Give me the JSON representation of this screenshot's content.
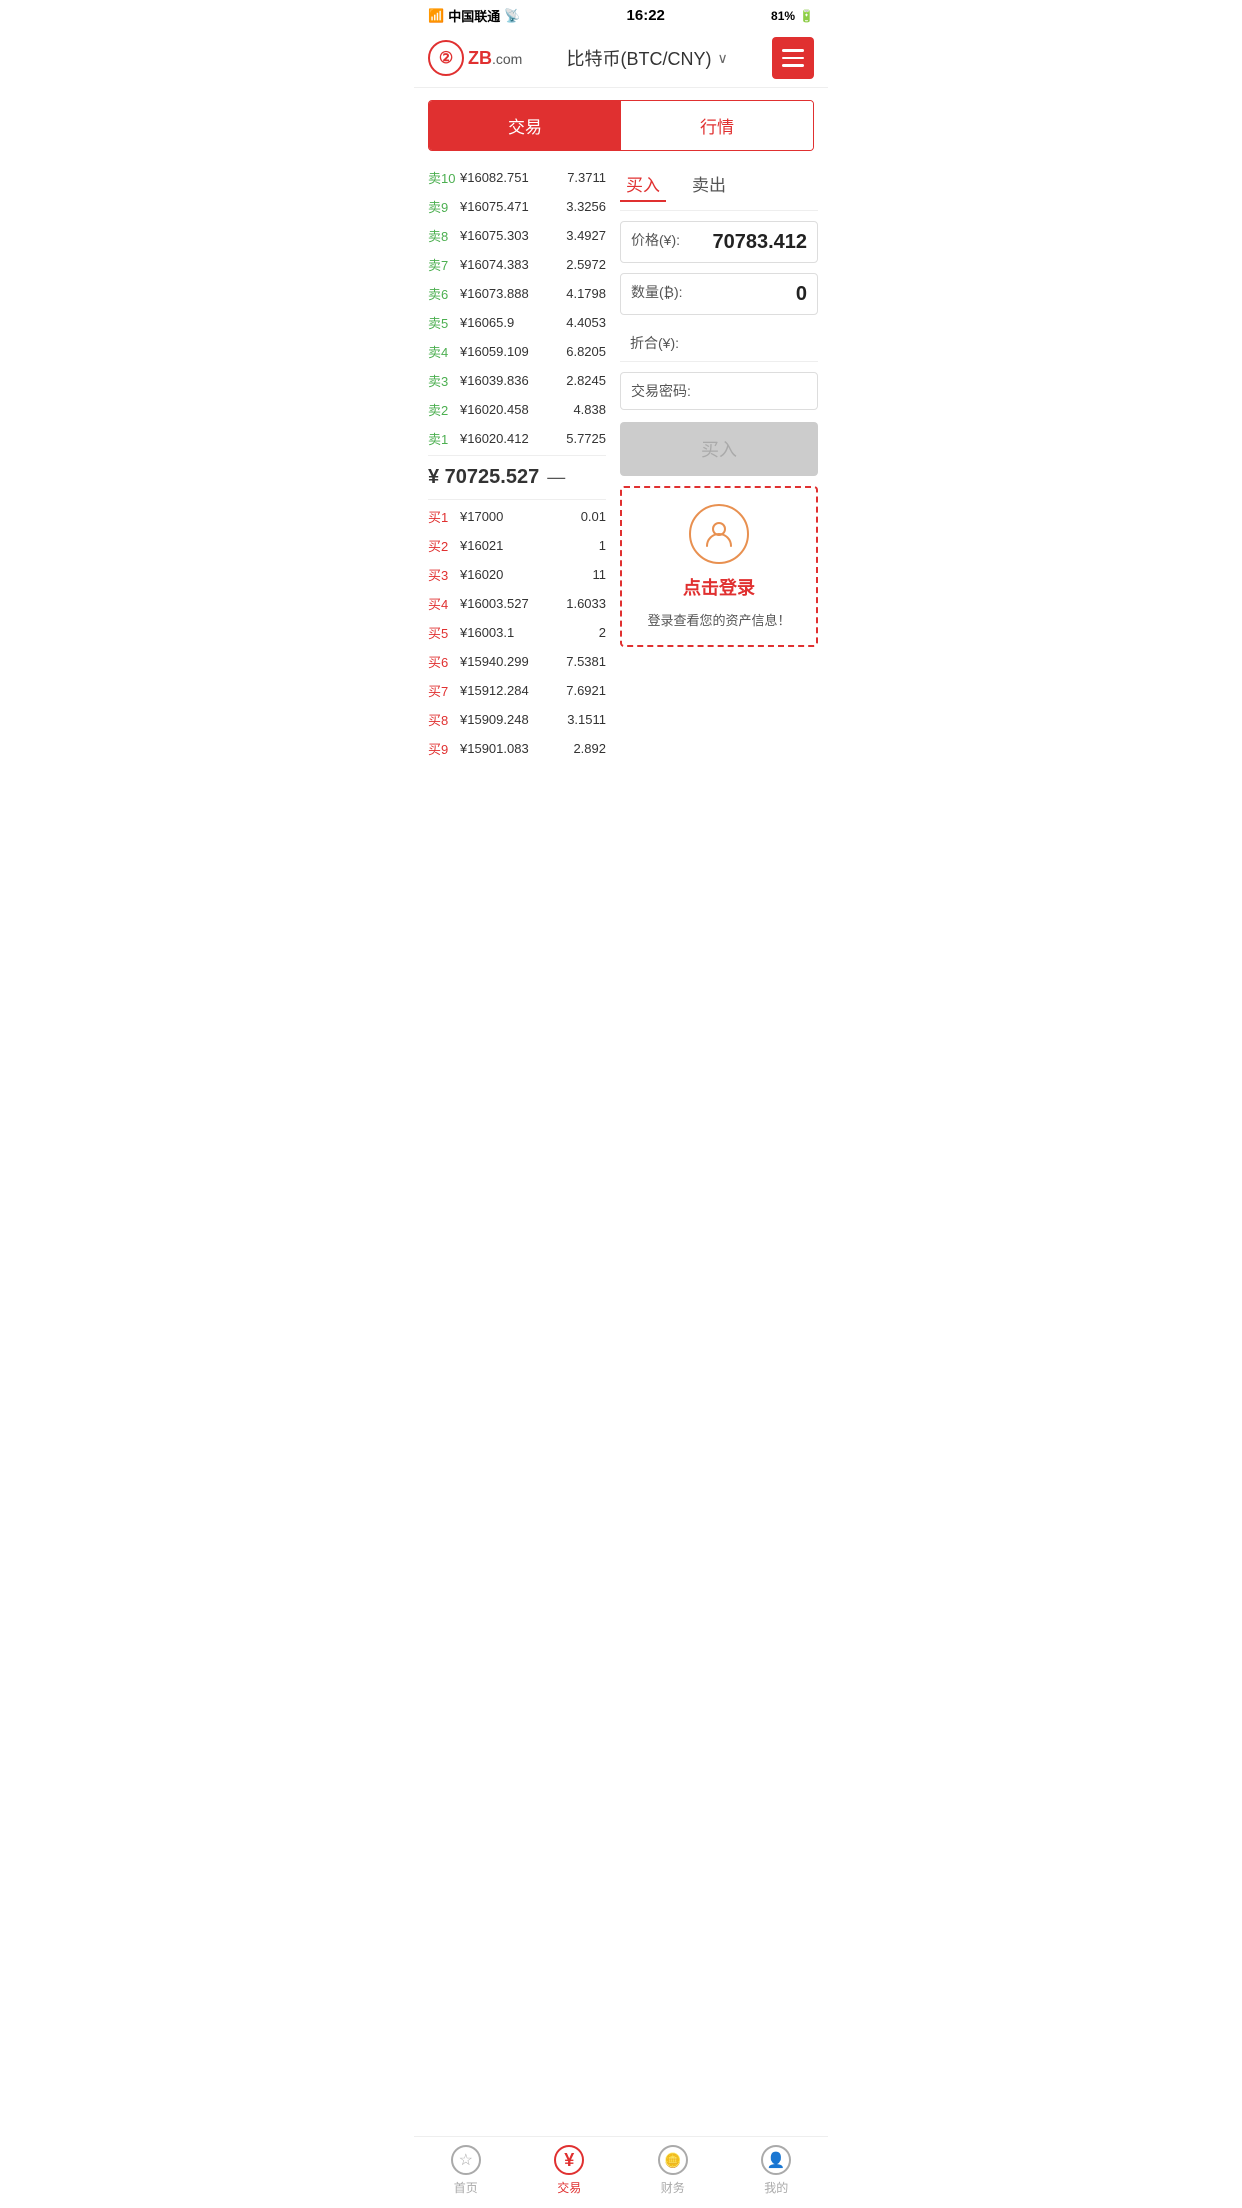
{
  "statusBar": {
    "carrier": "中国联通",
    "time": "16:22",
    "battery": "81%"
  },
  "header": {
    "logoText": "ZB",
    "logoDotCom": ".com",
    "title": "比特币(BTC/CNY)",
    "menuAriaLabel": "menu"
  },
  "tabs": {
    "tab1": "交易",
    "tab2": "行情",
    "activeTab": "tab1"
  },
  "orderBook": {
    "sellOrders": [
      {
        "label": "卖10",
        "price": "¥16082.751",
        "qty": "7.3711"
      },
      {
        "label": "卖9",
        "price": "¥16075.471",
        "qty": "3.3256"
      },
      {
        "label": "卖8",
        "price": "¥16075.303",
        "qty": "3.4927"
      },
      {
        "label": "卖7",
        "price": "¥16074.383",
        "qty": "2.5972"
      },
      {
        "label": "卖6",
        "price": "¥16073.888",
        "qty": "4.1798"
      },
      {
        "label": "卖5",
        "price": "¥16065.9",
        "qty": "4.4053"
      },
      {
        "label": "卖4",
        "price": "¥16059.109",
        "qty": "6.8205"
      },
      {
        "label": "卖3",
        "price": "¥16039.836",
        "qty": "2.8245"
      },
      {
        "label": "卖2",
        "price": "¥16020.458",
        "qty": "4.838"
      },
      {
        "label": "卖1",
        "price": "¥16020.412",
        "qty": "5.7725"
      }
    ],
    "currentPrice": "¥ 70725.527",
    "currentPriceIndicator": "—",
    "buyOrders": [
      {
        "label": "买1",
        "price": "¥17000",
        "qty": "0.01"
      },
      {
        "label": "买2",
        "price": "¥16021",
        "qty": "1"
      },
      {
        "label": "买3",
        "price": "¥16020",
        "qty": "11"
      },
      {
        "label": "买4",
        "price": "¥16003.527",
        "qty": "1.6033"
      },
      {
        "label": "买5",
        "price": "¥16003.1",
        "qty": "2"
      },
      {
        "label": "买6",
        "price": "¥15940.299",
        "qty": "7.5381"
      },
      {
        "label": "买7",
        "price": "¥15912.284",
        "qty": "7.6921"
      },
      {
        "label": "买8",
        "price": "¥15909.248",
        "qty": "3.1511"
      },
      {
        "label": "买9",
        "price": "¥15901.083",
        "qty": "2.892"
      }
    ]
  },
  "tradePanel": {
    "buyTab": "买入",
    "sellTab": "卖出",
    "priceLabel": "价格(¥):",
    "priceValue": "70783.412",
    "qtyLabel": "数量(₿):",
    "qtyValue": "0",
    "totalLabel": "折合(¥):",
    "passwordLabel": "交易密码:",
    "buyButton": "买入",
    "loginIcon": "👤",
    "loginText": "点击登录",
    "loginDesc": "登录查看您的资产信息！"
  },
  "bottomNav": {
    "items": [
      {
        "label": "首页",
        "icon": "☆",
        "active": false
      },
      {
        "label": "交易",
        "icon": "¥",
        "active": true
      },
      {
        "label": "财务",
        "icon": "💰",
        "active": false
      },
      {
        "label": "我的",
        "icon": "👤",
        "active": false
      }
    ]
  }
}
